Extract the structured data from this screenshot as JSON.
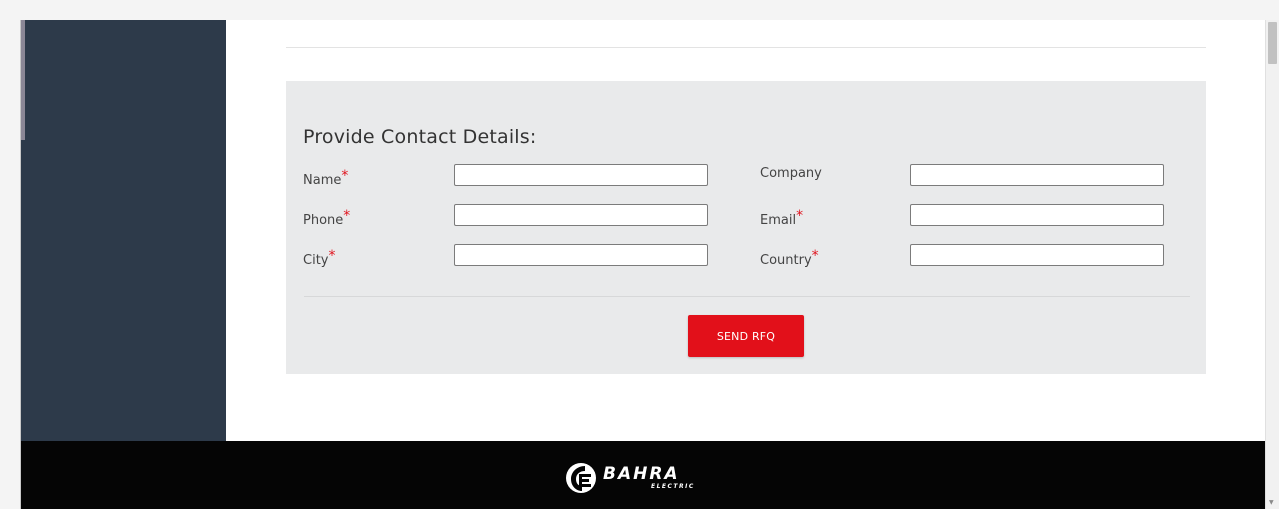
{
  "form": {
    "title": "Provide Contact Details:",
    "required_marker": "*",
    "fields": {
      "name": {
        "label": "Name",
        "value": "",
        "required": true
      },
      "company": {
        "label": "Company",
        "value": "",
        "required": false
      },
      "phone": {
        "label": "Phone",
        "value": "",
        "required": true
      },
      "email": {
        "label": "Email",
        "value": "",
        "required": true
      },
      "city": {
        "label": "City",
        "value": "",
        "required": true
      },
      "country": {
        "label": "Country",
        "value": "",
        "required": true
      }
    },
    "submit_label": "SEND RFQ"
  },
  "footer": {
    "logo_name": "BAHRA",
    "logo_sub": "ELECTRIC"
  },
  "colors": {
    "sidebar": "#2d3a4a",
    "panel": "#e9eaeb",
    "accent": "#e2101a",
    "footer": "#050505"
  }
}
